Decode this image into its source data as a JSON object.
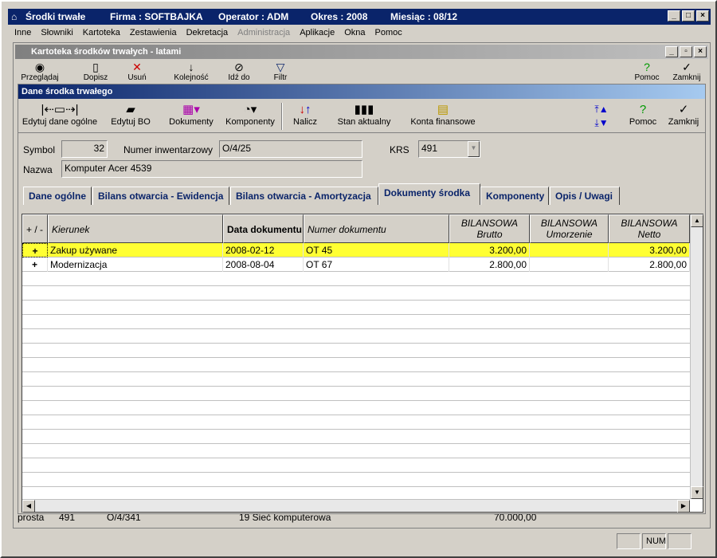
{
  "app": {
    "title": "Środki trwałe",
    "firma": "Firma : SOFTBAJKA",
    "operator": "Operator : ADM",
    "okres": "Okres : 2008",
    "miesiac": "Miesiąc : 08/12"
  },
  "menu": [
    "Inne",
    "Słowniki",
    "Kartoteka",
    "Zestawienia",
    "Dekretacja",
    "Administracja",
    "Aplikacje",
    "Okna",
    "Pomoc"
  ],
  "inner": {
    "title": "Kartoteka środków trwałych - latami",
    "toolbar": [
      "Przeglądaj",
      "Dopisz",
      "Usuń",
      "Kolejność",
      "Idź do",
      "Filtr",
      "Pomoc",
      "Zamknij"
    ]
  },
  "dialog": {
    "title": "Dane środka trwałego",
    "toolbar": {
      "edit_general": "Edytuj dane ogólne",
      "edit_bo": "Edytuj BO",
      "documents": "Dokumenty",
      "components": "Komponenty",
      "calculate": "Nalicz",
      "current_state": "Stan aktualny",
      "fin_accounts": "Konta finansowe",
      "help": "Pomoc",
      "close": "Zamknij"
    },
    "fields": {
      "symbol_label": "Symbol",
      "symbol_value": "32",
      "inv_label": "Numer inwentarzowy",
      "inv_value": "O/4/25",
      "krs_label": "KRS",
      "krs_value": "491",
      "name_label": "Nazwa",
      "name_value": "Komputer Acer 4539"
    },
    "tabs": [
      "Dane ogólne",
      "Bilans otwarcia - Ewidencja",
      "Bilans otwarcia - Amortyzacja",
      "Dokumenty środka",
      "Komponenty",
      "Opis / Uwagi"
    ],
    "grid": {
      "headers": {
        "plusminus": "+ / -",
        "kierunek": "Kierunek",
        "data": "Data dokumentu",
        "numer": "Numer dokumentu",
        "brutto1": "BILANSOWA",
        "brutto2": "Brutto",
        "umorz1": "BILANSOWA",
        "umorz2": "Umorzenie",
        "netto1": "BILANSOWA",
        "netto2": "Netto"
      },
      "rows": [
        {
          "sign": "+",
          "kierunek": "Zakup używane",
          "data": "2008-02-12",
          "numer": "OT 45",
          "brutto": "3.200,00",
          "umorzenie": "",
          "netto": "3.200,00"
        },
        {
          "sign": "+",
          "kierunek": "Modernizacja",
          "data": "2008-08-04",
          "numer": "OT 67",
          "brutto": "2.800,00",
          "umorzenie": "",
          "netto": "2.800,00"
        }
      ]
    }
  },
  "background_row": {
    "a": "prosta",
    "b": "491",
    "c": "O/4/341",
    "d": "19 Sieć komputerowa",
    "e": "70.000,00"
  },
  "status": {
    "num": "NUM"
  },
  "colors": {
    "title": "#0a246a",
    "highlight": "#ffff33"
  }
}
